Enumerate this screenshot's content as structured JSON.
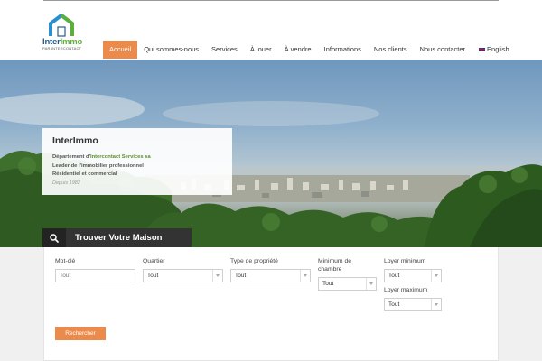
{
  "brand": {
    "name_part1": "Inter",
    "name_part2": "Immo",
    "tagline": "PAR INTERCONTACT"
  },
  "nav": {
    "items": [
      {
        "label": "Accueil",
        "active": true
      },
      {
        "label": "Qui sommes-nous",
        "active": false
      },
      {
        "label": "Services",
        "active": false
      },
      {
        "label": "À louer",
        "active": false
      },
      {
        "label": "À vendre",
        "active": false
      },
      {
        "label": "Informations",
        "active": false
      },
      {
        "label": "Nos clients",
        "active": false
      },
      {
        "label": "Nous contacter",
        "active": false
      }
    ],
    "language": "English"
  },
  "hero_card": {
    "title": "InterImmo",
    "line1_prefix": "Département d'",
    "line1_accent": "Intercontact Services sa",
    "line2": "Leader de l'immobilier professionnel",
    "line3": "Résidentiel et commercial",
    "since": "Depuis 1982"
  },
  "search": {
    "tab_label": "Trouver Votre Maison"
  },
  "form": {
    "keyword_label": "Mot-clé",
    "keyword_placeholder": "Tout",
    "quartier_label": "Quartier",
    "quartier_value": "Tout",
    "type_label": "Type de propriété",
    "type_value": "Tout",
    "rooms_label_1": "Minimum de",
    "rooms_label_2": "chambre",
    "rooms_value": "Tout",
    "rent_min_label": "Loyer minimum",
    "rent_min_value": "Tout",
    "rent_max_label": "Loyer maximum",
    "rent_max_value": "Tout",
    "submit_label": "Rechercher"
  },
  "colors": {
    "accent": "#ec8a4c",
    "dark": "#333333",
    "logo_blue": "#2a5c8a",
    "logo_green": "#5ab03a"
  }
}
